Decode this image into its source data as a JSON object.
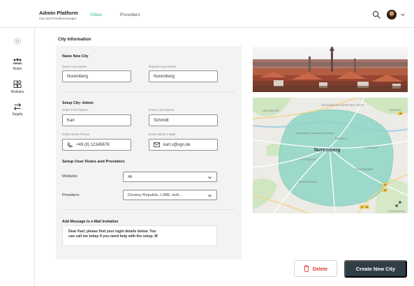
{
  "brand": {
    "title": "Admin Platform",
    "subtitle": "City and Providermanager"
  },
  "nav": {
    "tabs": [
      {
        "label": "Cities",
        "active": true
      },
      {
        "label": "Providers",
        "active": false
      }
    ]
  },
  "header_icons": {
    "search": "search-icon",
    "avatar": "user-avatar",
    "menu": "chevron-down-icon"
  },
  "sidebar": {
    "items": [
      {
        "label": "",
        "icon": "settings-icon"
      },
      {
        "label": "Roles",
        "icon": "roles-icon"
      },
      {
        "label": "Modules",
        "icon": "modules-icon"
      },
      {
        "label": "Supply",
        "icon": "swap-arrows-icon"
      }
    ]
  },
  "form": {
    "title": "City Information",
    "name_section": {
      "title": "Name New City",
      "enter_label": "Enter City Name",
      "enter_value": "Nuremberg",
      "repeat_label": "Repeat City Name",
      "repeat_value": "Nuremberg"
    },
    "admin_section": {
      "title": "Setup City- Admin",
      "first_label": "Enter First Name",
      "first_value": "Karl",
      "last_label": "Enter Last Name",
      "last_value": "Schmidt",
      "phone_label": "Enter Work Phone",
      "phone_value": "+49 (0) 12345678",
      "email_label": "Enter Work e-Mail",
      "email_value": "karl.s@vgn.de"
    },
    "roles_section": {
      "title": "Setup User Roles and Providers",
      "modules_label": "Modules",
      "modules_value": "All",
      "providers_label": "Providers",
      "providers_value": "Donkey Republic, LIME, bolt..."
    },
    "message_section": {
      "title": "Add Message to e-Mail Invitation",
      "line1": "Dear Karl,  please find your login details below. You",
      "line2": "can call me today if you need help with the setup. M"
    }
  },
  "map": {
    "city_label": "Nuremberg",
    "labels": [
      "NETZENDORF",
      "GROSSREUTH HINTER DER VESTE",
      "Burgmusem Kaiserburg Nürnberg",
      "ERLENST",
      "LOHENHOF",
      "MAXFELD",
      "GOSTENHOF",
      "GLEISHAMMER",
      "WEISSES HAUS"
    ],
    "road_badges": [
      "4",
      "4",
      "8",
      "4",
      "8"
    ],
    "credit": "© OpenStreetMap"
  },
  "actions": {
    "delete_label": "Delete",
    "create_label": "Create New City"
  },
  "colors": {
    "accent": "#25b09b",
    "primary_button": "#2f3d47",
    "danger": "#d93b35",
    "panel": "#f2f3f4",
    "map_area": "#8fd6c7"
  }
}
